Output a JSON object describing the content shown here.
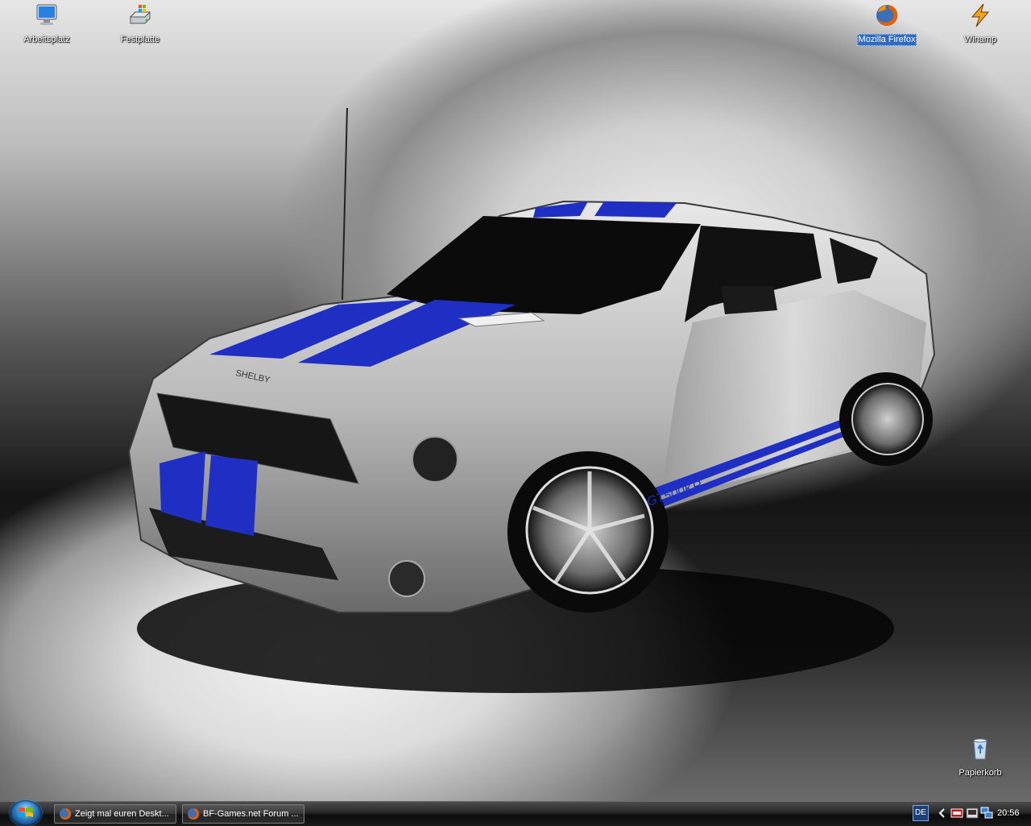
{
  "desktop": {
    "icons": [
      {
        "label": "Arbeitsplatz",
        "icon": "computer-icon"
      },
      {
        "label": "Festplatte",
        "icon": "hard-drive-icon"
      },
      {
        "label": "Mozilla Firefox",
        "icon": "firefox-icon",
        "selected": true
      },
      {
        "label": "Winamp",
        "icon": "winamp-icon"
      },
      {
        "label": "Papierkorb",
        "icon": "recycle-bin-icon"
      }
    ],
    "wallpaper": {
      "subject": "silver car with blue racing stripes",
      "hood_text": "SHELBY",
      "side_text": "GT500KR",
      "colors": {
        "stripe": "#1f2fc4",
        "body": "#c9c9c9"
      }
    }
  },
  "taskbar": {
    "start_button": "start-orb",
    "tasks": [
      {
        "label": "Zeigt mal euren Deskt...",
        "icon": "firefox-icon"
      },
      {
        "label": "BF-Games.net Forum ...",
        "icon": "firefox-icon"
      }
    ],
    "language": "DE",
    "clock": "20:56"
  }
}
